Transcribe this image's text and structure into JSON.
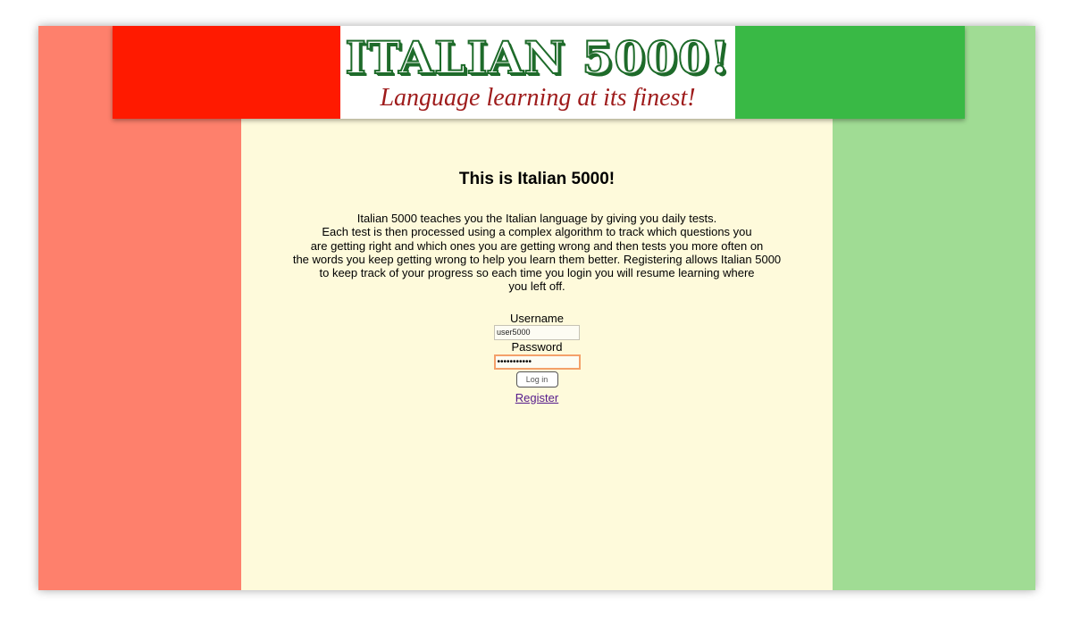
{
  "header": {
    "logo_title": "ITALIAN 5000!",
    "logo_tagline": "Language learning at its finest!"
  },
  "main": {
    "title": "This is Italian 5000!",
    "intro_lines": [
      "Italian 5000 teaches you the Italian language by giving you daily tests.",
      "Each test is then processed using a complex algorithm to track which questions you",
      "are getting right and which ones you are getting wrong and then tests you more often on",
      "the words you keep getting wrong to help you learn them better. Registering allows Italian 5000",
      "to keep track of your progress so each time you login you will resume learning where",
      "you left off."
    ]
  },
  "login": {
    "username_label": "Username",
    "username_value": "user5000",
    "password_label": "Password",
    "password_value": "•••••••••••",
    "login_button": "Log in",
    "register_link": "Register"
  },
  "colors": {
    "side_left": "#fe806c",
    "side_right": "#a0dc94",
    "content_bg": "#fefadb",
    "flag_red": "#ff1a00",
    "flag_green": "#39b945",
    "logo_green": "#1e6b2a",
    "tagline_red": "#9e1b1b"
  }
}
